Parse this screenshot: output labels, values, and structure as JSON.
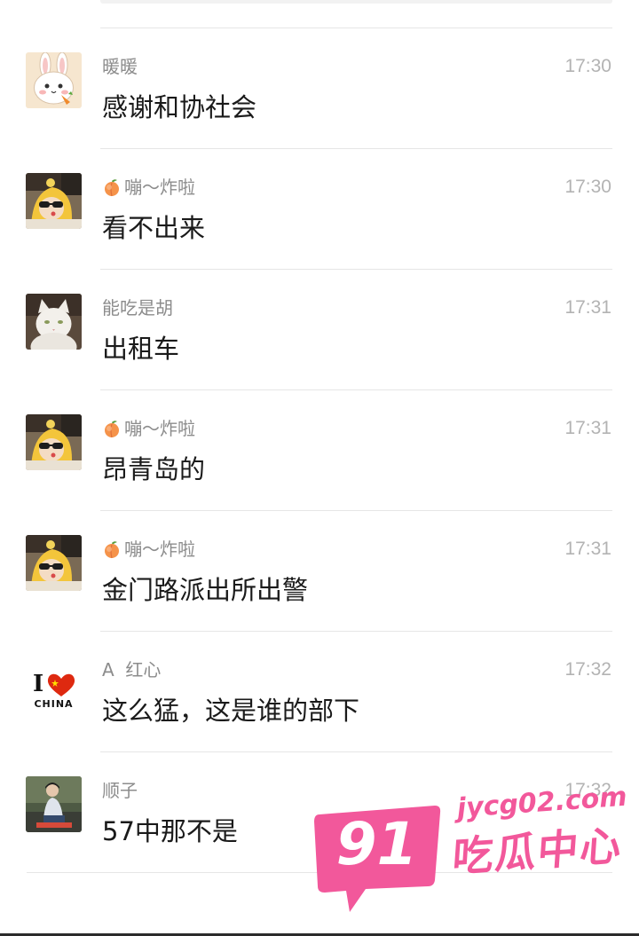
{
  "messages": [
    {
      "sender": "暖暖",
      "time": "17:30",
      "text": "感谢和协社会",
      "avatar_icon": "bunny-avatar",
      "prefix_icon": ""
    },
    {
      "sender": "嘣～炸啦",
      "time": "17:30",
      "text": "看不出来",
      "avatar_icon": "yellow-hood-child-avatar",
      "prefix_icon": "peach-icon"
    },
    {
      "sender": "能吃是胡",
      "time": "17:31",
      "text": "出租车",
      "avatar_icon": "white-cat-avatar",
      "prefix_icon": ""
    },
    {
      "sender": "嘣～炸啦",
      "time": "17:31",
      "text": "昂青岛的",
      "avatar_icon": "yellow-hood-child-avatar",
      "prefix_icon": "peach-icon"
    },
    {
      "sender": "嘣～炸啦",
      "time": "17:31",
      "text": "金门路派出所出警",
      "avatar_icon": "yellow-hood-child-avatar",
      "prefix_icon": "peach-icon"
    },
    {
      "sender": "A  红心",
      "time": "17:32",
      "text": "这么猛，这是谁的部下",
      "avatar_icon": "i-love-china-avatar",
      "prefix_icon": ""
    },
    {
      "sender": "顺子",
      "time": "17:32",
      "text": "57中那不是",
      "avatar_icon": "person-photo-avatar",
      "prefix_icon": ""
    }
  ],
  "avatar_text": {
    "i_letter": "I",
    "china": "CHINA"
  },
  "watermark": {
    "number": "91",
    "url": "jycg02.com",
    "brand": "吃瓜中心",
    "color": "#f2589b"
  },
  "colors": {
    "sender": "#8c8c8c",
    "time": "#b3b3b3",
    "content": "#1a1a1a",
    "divider": "#e6e6e6"
  }
}
